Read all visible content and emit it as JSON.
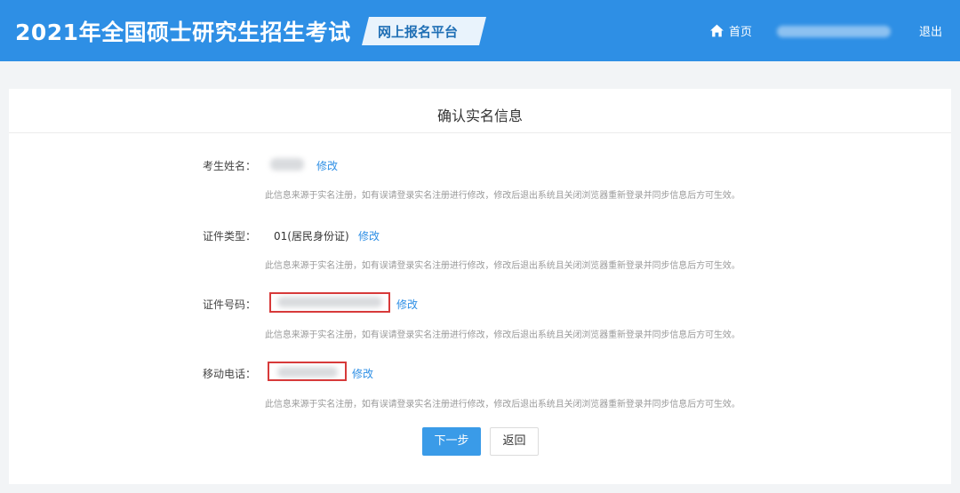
{
  "header": {
    "site_title": "2021年全国硕士研究生招生考试",
    "platform_badge": "网上报名平台",
    "home_label": "首页",
    "logout_label": "退出",
    "icon": "home-icon",
    "background_color": "#2e8fe5"
  },
  "card": {
    "title": "确认实名信息"
  },
  "fields": [
    {
      "label": "考生姓名：",
      "value": "",
      "edit_label": "修改",
      "hint": "此信息来源于实名注册，如有误请登录实名注册进行修改，修改后退出系统且关闭浏览器重新登录并同步信息后方可生效。"
    },
    {
      "label": "证件类型：",
      "value": "01(居民身份证)",
      "edit_label": "修改",
      "hint": "此信息来源于实名注册，如有误请登录实名注册进行修改，修改后退出系统且关闭浏览器重新登录并同步信息后方可生效。"
    },
    {
      "label": "证件号码：",
      "value": "",
      "edit_label": "修改",
      "hint": "此信息来源于实名注册，如有误请登录实名注册进行修改，修改后退出系统且关闭浏览器重新登录并同步信息后方可生效。"
    },
    {
      "label": "移动电话：",
      "value": "",
      "edit_label": "修改",
      "hint": "此信息来源于实名注册，如有误请登录实名注册进行修改，修改后退出系统且关闭浏览器重新登录并同步信息后方可生效。"
    }
  ],
  "actions": {
    "next_label": "下一步",
    "back_label": "返回"
  },
  "colors": {
    "accent": "#2e8fe5",
    "highlight_border": "#d73a3a"
  }
}
